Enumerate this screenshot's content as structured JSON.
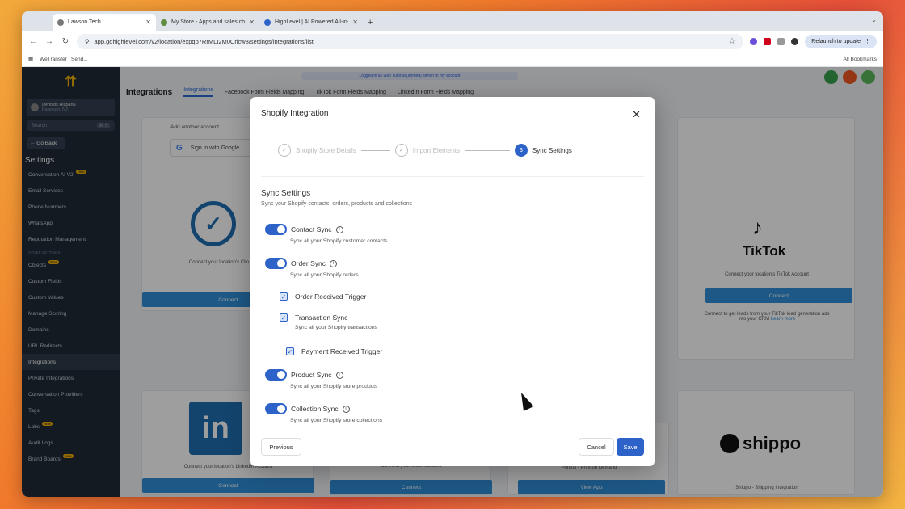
{
  "browser": {
    "tabs": [
      {
        "title": "Lawson Tech",
        "active": true
      },
      {
        "title": "My Store - Apps and sales ch..."
      },
      {
        "title": "HighLevel | AI Powered All-in-..."
      }
    ],
    "url": "app.gohighlevel.com/v2/location/expqp7RrMLI2M0Cricw8/settings/integrations/list",
    "relaunch_label": "Relaunch to update",
    "bookmark": "WeTransfer | Send...",
    "all_bookmarks": "All Bookmarks"
  },
  "sidebar": {
    "account_name": "Dentists Hispana",
    "account_loc": "Paterson, NJ",
    "search_placeholder": "Search",
    "search_shortcut": "⌘ K",
    "go_back": "← Go Back",
    "settings_title": "Settings",
    "items": [
      {
        "label": "Conversation AI V2",
        "badge": "New"
      },
      {
        "label": "Email Services"
      },
      {
        "label": "Phone Numbers"
      },
      {
        "label": "WhatsApp"
      },
      {
        "label": "Reputation Management"
      },
      {
        "label": "OTHER SETTINGS",
        "section": true
      },
      {
        "label": "Objects",
        "badge": "New"
      },
      {
        "label": "Custom Fields"
      },
      {
        "label": "Custom Values"
      },
      {
        "label": "Manage Scoring"
      },
      {
        "label": "Domains"
      },
      {
        "label": "URL Redirects"
      },
      {
        "label": "Integrations",
        "active": true
      },
      {
        "label": "Private Integrations"
      },
      {
        "label": "Conversation Providers"
      },
      {
        "label": "Tags"
      },
      {
        "label": "Labs",
        "badge": "New"
      },
      {
        "label": "Audit Logs"
      },
      {
        "label": "Brand Boards",
        "badge": "New"
      }
    ]
  },
  "main": {
    "banner": "Logged in as Gbp Tutorial (ahmed) switch to my account",
    "page_title": "Integrations",
    "subnav": [
      "Integrations",
      "Facebook Form Fields Mapping",
      "TikTok Form Fields Mapping",
      "LinkedIn Form Fields Mapping"
    ],
    "add_account": "Add another account",
    "google_signin": "Sign in with Google",
    "clio_text": "Connect your location's Clio Account",
    "connect": "Connect",
    "tiktok_brand": "TikTok",
    "tiktok_text": "Connect your location's TikTok Account",
    "tiktok_desc": "Connect to get leads from your TikTok lead generation ads into your CRM",
    "learn_more": "Learn more",
    "linkedin_text": "Connect your location's LinkedIn Account",
    "slack_text": "Connect your Slack account",
    "print_text": "Printful - Print on Demand",
    "view_app": "View App",
    "shippo_brand": "shippo",
    "shippo_text": "Shippo - Shipping Integration"
  },
  "modal": {
    "title": "Shopify Integration",
    "steps": [
      {
        "num": "✓",
        "label": "Shopify Store Details"
      },
      {
        "num": "✓",
        "label": "Import Elements"
      },
      {
        "num": "3",
        "label": "Sync Settings",
        "current": true
      }
    ],
    "section_title": "Sync Settings",
    "section_sub": "Sync your Shopify contacts, orders, products and collections",
    "contact_sync": {
      "label": "Contact Sync",
      "desc": "Sync all your Shopify customer contacts"
    },
    "order_sync": {
      "label": "Order Sync",
      "desc": "Sync all your Shopify orders"
    },
    "order_received": {
      "label": "Order Received Trigger"
    },
    "transaction_sync": {
      "label": "Transaction Sync",
      "desc": "Sync all your Shopify transactions"
    },
    "payment_received": {
      "label": "Payment Received Trigger"
    },
    "product_sync": {
      "label": "Product Sync",
      "desc": "Sync all your Shopify store products"
    },
    "collection_sync": {
      "label": "Collection Sync",
      "desc": "Sync all your Shopify store collections"
    },
    "previous": "Previous",
    "cancel": "Cancel",
    "save": "Save"
  },
  "colors": {
    "accent": "#2d62c8",
    "sidebar": "#1f2a37",
    "connect": "#2f8fd8"
  }
}
